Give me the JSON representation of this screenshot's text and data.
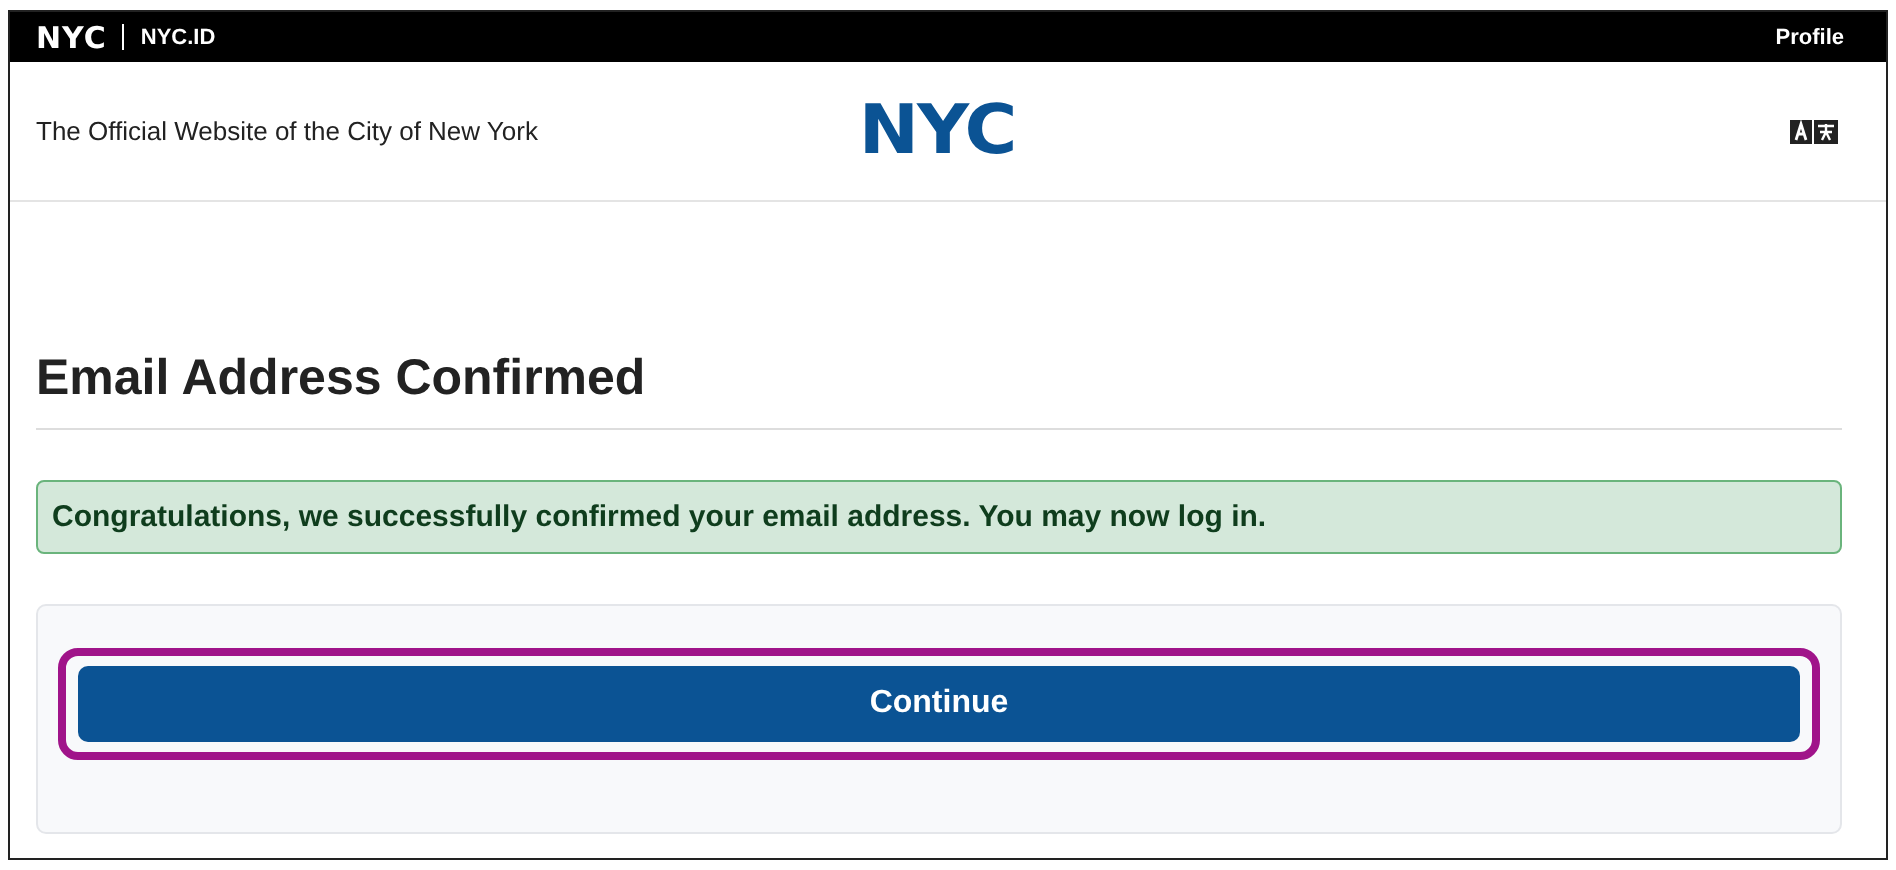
{
  "top_bar": {
    "logo": "NYC",
    "site": "NYC.ID",
    "profile": "Profile"
  },
  "header": {
    "tagline": "The Official Website of the City of New York",
    "logo": "NYC"
  },
  "page": {
    "title": "Email Address Confirmed"
  },
  "alert": {
    "kind": "success",
    "message": "Congratulations, we successfully confirmed your email address. You may now log in."
  },
  "continue_button": {
    "label": "Continue",
    "highlighted": true
  }
}
